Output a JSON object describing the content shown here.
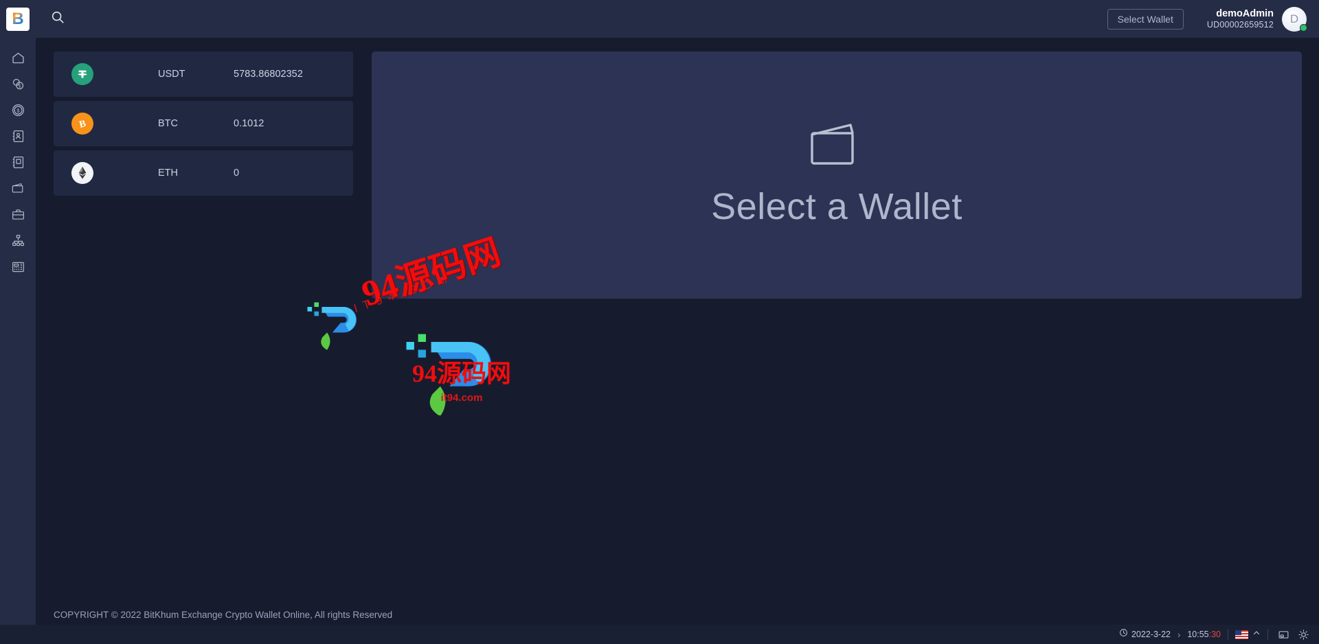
{
  "header": {
    "logo_letter": "B",
    "search_icon": "search-icon",
    "select_wallet_label": "Select Wallet",
    "user_name": "demoAdmin",
    "user_id": "UD00002659512",
    "avatar_initial": "D",
    "status_color": "#2ec16b"
  },
  "sidebar": {
    "items": [
      {
        "icon": "home-icon",
        "label": "Home"
      },
      {
        "icon": "coins-icon",
        "label": "Coins"
      },
      {
        "icon": "dollar-circle-icon",
        "label": "Currency"
      },
      {
        "icon": "contact-book-icon",
        "label": "Address Book"
      },
      {
        "icon": "notebook-icon",
        "label": "Ledger"
      },
      {
        "icon": "wallet-folder-icon",
        "label": "Wallets"
      },
      {
        "icon": "briefcase-icon",
        "label": "Portfolio"
      },
      {
        "icon": "sitemap-icon",
        "label": "Network"
      },
      {
        "icon": "calculator-icon",
        "label": "Reports"
      }
    ]
  },
  "coins": [
    {
      "icon": "usdt-icon",
      "symbol": "T",
      "name": "USDT",
      "amount": "5783.86802352",
      "color": "#26a17b"
    },
    {
      "icon": "btc-icon",
      "symbol": "Ƀ",
      "name": "BTC",
      "amount": "0.1012",
      "color": "#f7931a"
    },
    {
      "icon": "eth-icon",
      "symbol": "⧫",
      "name": "ETH",
      "amount": "0",
      "color": "#f2f4f8"
    }
  ],
  "main_panel": {
    "icon": "wallet-icon",
    "empty_text": "Select a Wallet"
  },
  "watermark": {
    "top_cn": "94源码网",
    "top_url": "IT94.COM",
    "bottom_cn": "94源码网",
    "bottom_url": "it94.com",
    "color": "#f30c0c"
  },
  "footer": {
    "copyright": "COPYRIGHT © 2022 BitKhum Exchange Crypto Wallet Online, All rights Reserved"
  },
  "taskbar": {
    "clock_icon": "clock-icon",
    "date": "2022-3-22",
    "separator": "›",
    "time": "10:55",
    "seconds": ":30",
    "seconds_color": "#e8453c",
    "flag_icon": "us-flag-icon",
    "chevron_icon": "chevron-up-icon",
    "display_icon": "display-icon",
    "brightness_icon": "brightness-icon"
  }
}
